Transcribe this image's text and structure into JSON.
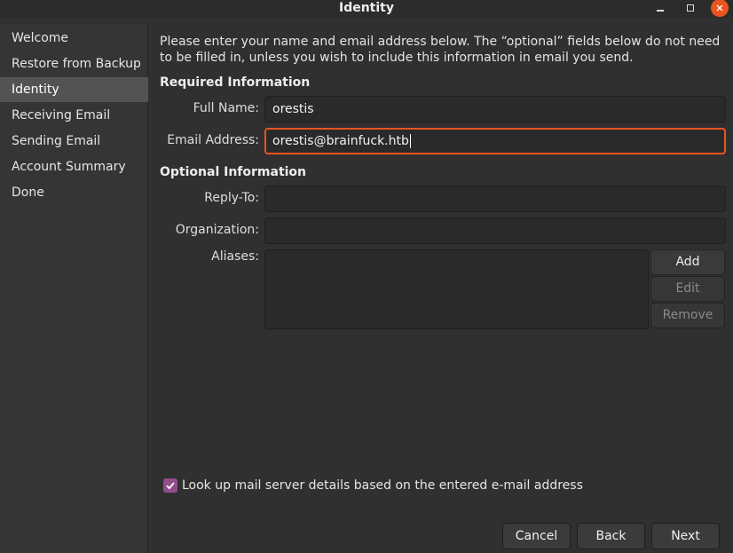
{
  "window": {
    "title": "Identity"
  },
  "sidebar": {
    "items": [
      {
        "label": "Welcome"
      },
      {
        "label": "Restore from Backup"
      },
      {
        "label": "Identity"
      },
      {
        "label": "Receiving Email"
      },
      {
        "label": "Sending Email"
      },
      {
        "label": "Account Summary"
      },
      {
        "label": "Done"
      }
    ],
    "active": "Identity"
  },
  "main": {
    "intro": "Please enter your name and email address below. The “optional” fields below do not need to be filled in, unless you wish to include this information in email you send.",
    "required": {
      "heading": "Required Information",
      "full_name_label": "Full Name:",
      "full_name_value": "orestis",
      "email_label": "Email Address:",
      "email_value": "orestis@brainfuck.htb"
    },
    "optional": {
      "heading": "Optional Information",
      "reply_to_label": "Reply-To:",
      "reply_to_value": "",
      "organization_label": "Organization:",
      "organization_value": "",
      "aliases_label": "Aliases:",
      "add_label": "Add",
      "edit_label": "Edit",
      "remove_label": "Remove"
    },
    "lookup": {
      "checked": true,
      "label": "Look up mail server details based on the entered e-mail address"
    }
  },
  "footer": {
    "cancel_label": "Cancel",
    "back_label": "Back",
    "next_label": "Next"
  },
  "colors": {
    "accent": "#e95420",
    "checkbox": "#924d8b",
    "background": "#303030",
    "sidebar_active": "#535353"
  }
}
